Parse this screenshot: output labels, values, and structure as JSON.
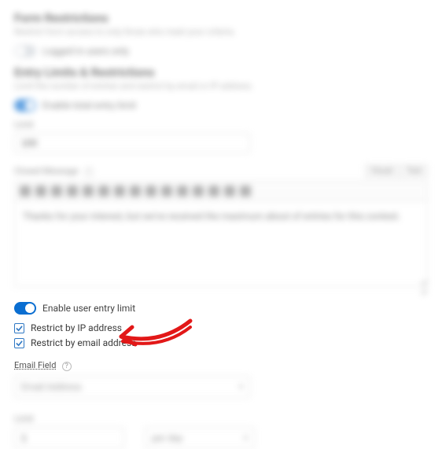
{
  "blurred_top": {
    "form_restrictions": {
      "title": "Form Restrictions",
      "subtitle": "Restrict form access to only those who meet your criteria.",
      "toggle_label": "Logged in users only"
    },
    "entry_limits": {
      "title": "Entry Limits & Restrictions",
      "subtitle": "Limit the number of entries and restrict by email or IP address.",
      "toggle_label": "Enable total entry limit",
      "limit_label": "Limit",
      "limit_value": "100",
      "closed_message_label": "Closed Message",
      "tabs": {
        "visual": "Visual",
        "text": "Text"
      },
      "closed_message_body": "Thanks for your interest, but we've received the maximum about of entries for this contest."
    }
  },
  "focus": {
    "enable_user_entry_limit": "Enable user entry limit",
    "restrict_ip": "Restrict by IP address",
    "restrict_email": "Restrict by email address",
    "email_field_label": "Email Field"
  },
  "blurred_bottom": {
    "email_field_value": "Email Address",
    "limit_label": "Limit",
    "limit_value": "1",
    "per_label": "per day"
  },
  "colors": {
    "accent": "#0a6ed1",
    "arrow": "#e21818"
  }
}
